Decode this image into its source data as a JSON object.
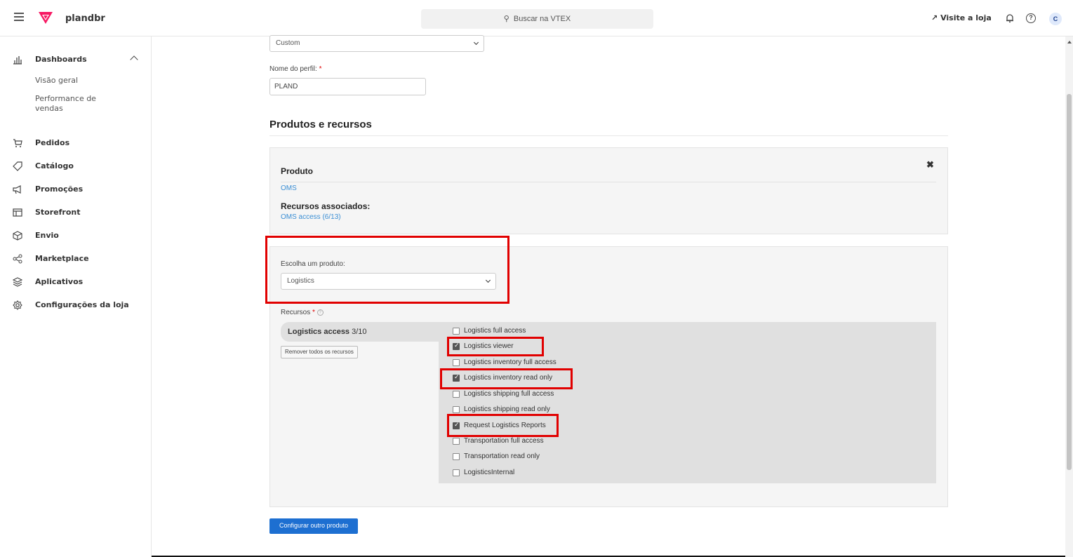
{
  "header": {
    "store_name": "plandbr",
    "search_placeholder": "Buscar na VTEX",
    "visit_store": "Visite a loja",
    "user_initial": "C"
  },
  "sidebar": {
    "dashboards": "Dashboards",
    "dashboard_children": [
      "Visão geral",
      "Performance de vendas"
    ],
    "items": [
      "Pedidos",
      "Catálogo",
      "Promoções",
      "Storefront",
      "Envio",
      "Marketplace",
      "Aplicativos",
      "Configurações da loja"
    ]
  },
  "form": {
    "top_select_value": "Custom",
    "profile_name_label": "Nome do perfil:",
    "required_mark": "*",
    "profile_name_value": "PLAND",
    "section_title": "Produtos e recursos"
  },
  "product_card": {
    "title": "Produto",
    "product": "OMS",
    "resources_title": "Recursos associados:",
    "resources_link": "OMS access (6/13)",
    "close": "✖"
  },
  "chooser": {
    "label": "Escolha um produto:",
    "selected": "Logistics",
    "resources_label": "Recursos",
    "info_icon": "?",
    "group_name": "Logistics access",
    "group_count": "3/10",
    "remove_all": "Remover todos os recursos",
    "resources": [
      {
        "label": "Logistics full access",
        "checked": false
      },
      {
        "label": "Logistics viewer",
        "checked": true
      },
      {
        "label": "Logistics inventory full access",
        "checked": false
      },
      {
        "label": "Logistics inventory read only",
        "checked": true
      },
      {
        "label": "Logistics shipping full access",
        "checked": false
      },
      {
        "label": "Logistics shipping read only",
        "checked": false
      },
      {
        "label": "Request Logistics Reports",
        "checked": true
      },
      {
        "label": "Transportation full access",
        "checked": false
      },
      {
        "label": "Transportation read only",
        "checked": false
      },
      {
        "label": "LogisticsInternal",
        "checked": false
      }
    ]
  },
  "actions": {
    "configure_other": "Configurar outro produto"
  },
  "colors": {
    "highlight": "#e10000",
    "primary": "#1d6fd1",
    "link": "#3a8ed4",
    "brand": "#f71963"
  }
}
